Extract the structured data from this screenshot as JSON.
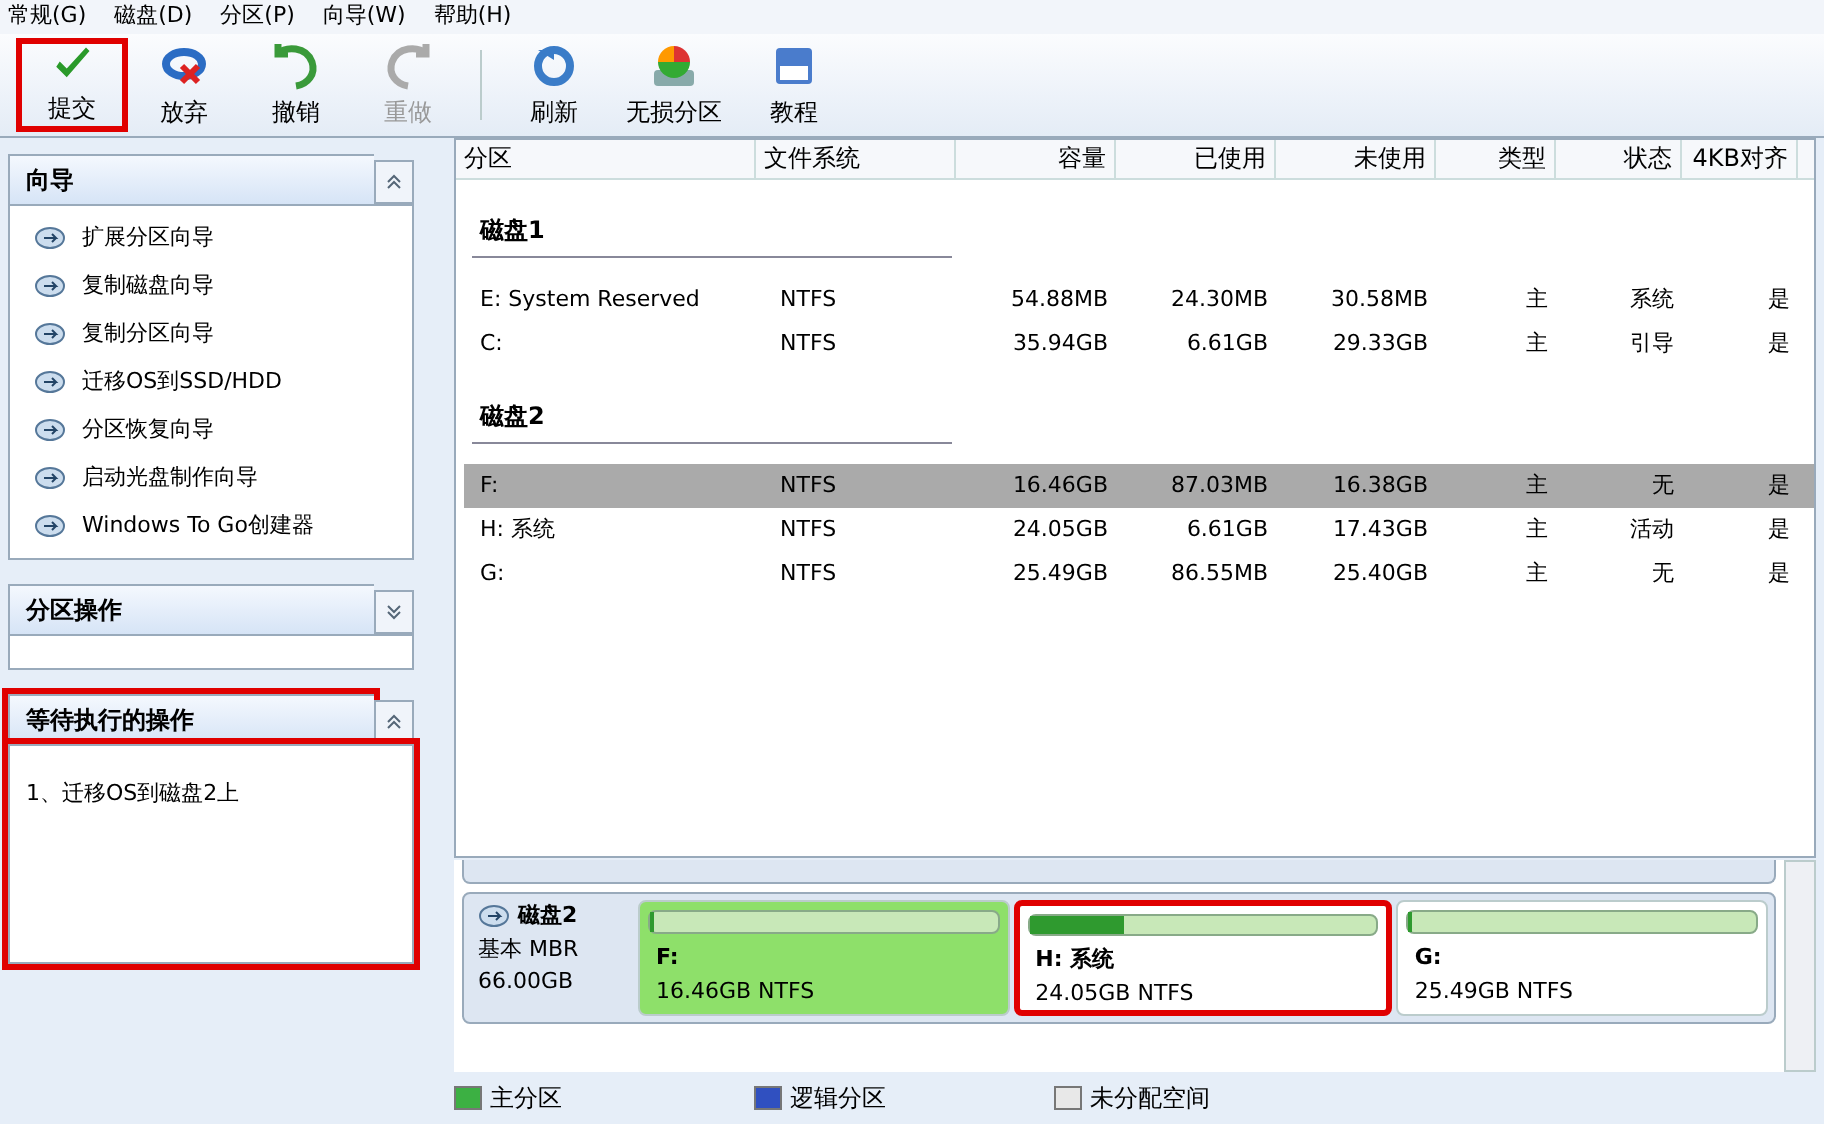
{
  "menu": [
    "常规(G)",
    "磁盘(D)",
    "分区(P)",
    "向导(W)",
    "帮助(H)"
  ],
  "toolbar": [
    {
      "label": "提交",
      "disabled": false,
      "highlighted": true,
      "separator_after": false
    },
    {
      "label": "放弃",
      "disabled": false,
      "highlighted": false,
      "separator_after": false
    },
    {
      "label": "撤销",
      "disabled": false,
      "highlighted": false,
      "separator_after": false
    },
    {
      "label": "重做",
      "disabled": true,
      "highlighted": false,
      "separator_after": true
    },
    {
      "label": "刷新",
      "disabled": false,
      "highlighted": false,
      "separator_after": false
    },
    {
      "label": "无损分区",
      "disabled": false,
      "highlighted": false,
      "separator_after": false
    },
    {
      "label": "教程",
      "disabled": false,
      "highlighted": false,
      "separator_after": false
    }
  ],
  "sidebar": {
    "panels": [
      {
        "title": "向导",
        "expanded": true,
        "highlighted": false,
        "items": [
          "扩展分区向导",
          "复制磁盘向导",
          "复制分区向导",
          "迁移OS到SSD/HDD",
          "分区恢复向导",
          "启动光盘制作向导",
          "Windows To Go创建器"
        ]
      },
      {
        "title": "分区操作",
        "expanded": false,
        "highlighted": false
      },
      {
        "title": "等待执行的操作",
        "expanded": true,
        "highlighted": true,
        "items": [
          "1、迁移OS到磁盘2上"
        ]
      }
    ]
  },
  "table": {
    "columns": [
      "分区",
      "文件系统",
      "容量",
      "已使用",
      "未使用",
      "类型",
      "状态",
      "4KB对齐"
    ],
    "groups": [
      {
        "title": "磁盘1",
        "rows": [
          {
            "cells": [
              "E: System Reserved",
              "NTFS",
              "54.88MB",
              "24.30MB",
              "30.58MB",
              "主",
              "系统",
              "是"
            ],
            "selected": false
          },
          {
            "cells": [
              "C:",
              "NTFS",
              "35.94GB",
              "6.61GB",
              "29.33GB",
              "主",
              "引导",
              "是"
            ],
            "selected": false
          }
        ]
      },
      {
        "title": "磁盘2",
        "rows": [
          {
            "cells": [
              "F:",
              "NTFS",
              "16.46GB",
              "87.03MB",
              "16.38GB",
              "主",
              "无",
              "是"
            ],
            "selected": true
          },
          {
            "cells": [
              "H: 系统",
              "NTFS",
              "24.05GB",
              "6.61GB",
              "17.43GB",
              "主",
              "活动",
              "是"
            ],
            "selected": false
          },
          {
            "cells": [
              "G:",
              "NTFS",
              "25.49GB",
              "86.55MB",
              "25.40GB",
              "主",
              "无",
              "是"
            ],
            "selected": false
          }
        ]
      }
    ]
  },
  "disk_map": {
    "disk": {
      "name": "磁盘2",
      "type": "基本 MBR",
      "size": "66.00GB"
    },
    "partitions": [
      {
        "name": "F:",
        "detail": "16.46GB NTFS",
        "selected": true,
        "highlighted": false,
        "level": 0.01
      },
      {
        "name": "H: 系统",
        "detail": "24.05GB NTFS",
        "selected": false,
        "highlighted": true,
        "level": 0.27
      },
      {
        "name": "G:",
        "detail": "25.49GB NTFS",
        "selected": false,
        "highlighted": false,
        "level": 0.01
      }
    ]
  },
  "legend": [
    {
      "label": "主分区",
      "color": "#3cb043"
    },
    {
      "label": "逻辑分区",
      "color": "#3050c0"
    },
    {
      "label": "未分配空间",
      "color": "#e8e8e8"
    }
  ]
}
